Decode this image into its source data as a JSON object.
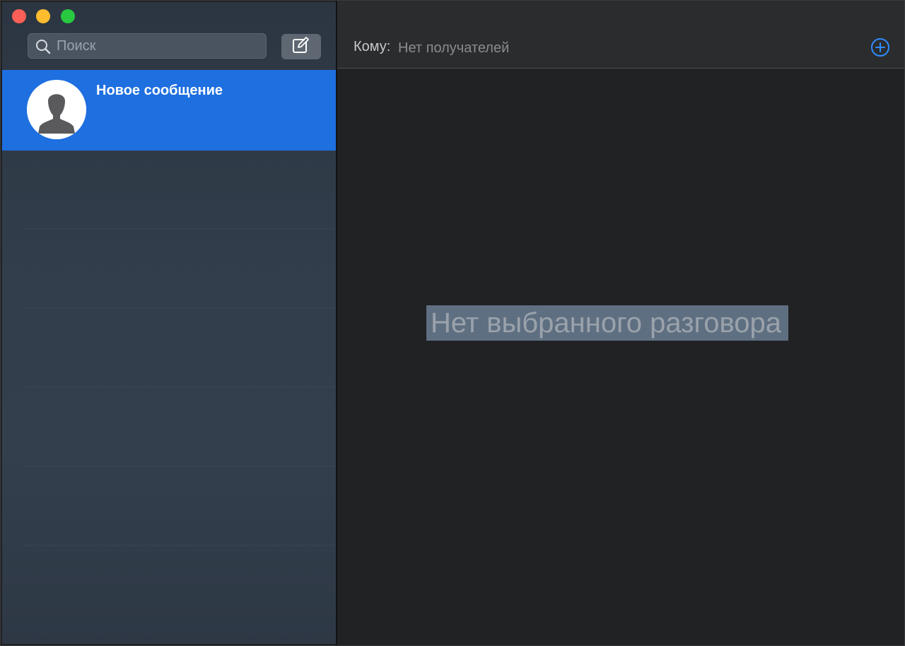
{
  "sidebar": {
    "search": {
      "placeholder": "Поиск"
    },
    "conversations": [
      {
        "title": "Новое сообщение",
        "selected": true
      }
    ]
  },
  "main": {
    "to_label": "Кому:",
    "to_placeholder": "Нет получателей",
    "empty_state": "Нет выбранного разговора"
  },
  "colors": {
    "selection": "#1e6fe0",
    "accent": "#2f8cff",
    "close": "#fe5f57",
    "minimize": "#febc2e",
    "zoom": "#28c840"
  },
  "icons": {
    "search": "search-icon",
    "compose": "compose-icon",
    "avatar": "person-silhouette-icon",
    "add": "plus-circle-icon"
  }
}
